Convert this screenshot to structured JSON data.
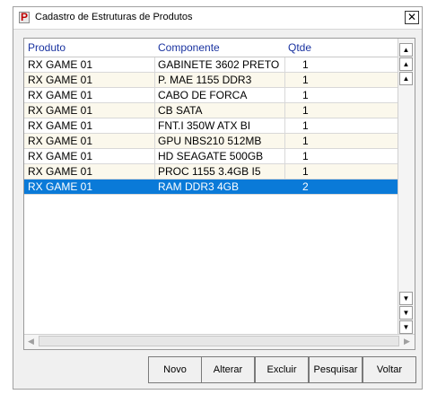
{
  "window": {
    "title": "Cadastro de Estruturas de Produtos",
    "close_glyph": "✕"
  },
  "grid": {
    "columns": [
      "Produto",
      "Componente",
      "Qtde"
    ],
    "rows": [
      {
        "produto": "RX GAME 01",
        "componente": "GABINETE 3602 PRETO",
        "qtde": "1"
      },
      {
        "produto": "RX GAME 01",
        "componente": "P. MAE 1155 DDR3",
        "qtde": "1"
      },
      {
        "produto": "RX GAME 01",
        "componente": "CABO DE FORCA",
        "qtde": "1"
      },
      {
        "produto": "RX GAME 01",
        "componente": "CB SATA",
        "qtde": "1"
      },
      {
        "produto": "RX GAME 01",
        "componente": "FNT.I 350W ATX BI",
        "qtde": "1"
      },
      {
        "produto": "RX GAME 01",
        "componente": "GPU NBS210 512MB",
        "qtde": "1"
      },
      {
        "produto": "RX GAME 01",
        "componente": "HD SEAGATE 500GB",
        "qtde": "1"
      },
      {
        "produto": "RX GAME 01",
        "componente": "PROC 1155 3.4GB I5",
        "qtde": "1"
      },
      {
        "produto": "RX GAME 01",
        "componente": "RAM DDR3 4GB",
        "qtde": "2"
      }
    ],
    "selected_row": 8
  },
  "buttons": {
    "novo": "Novo",
    "alterar": "Alterar",
    "excluir": "Excluir",
    "pesquisar": "Pesquisar",
    "voltar": "Voltar"
  },
  "colors": {
    "header_text": "#1a33a0",
    "selection": "#0a7ad8",
    "alt_row": "#fbf8ec"
  }
}
